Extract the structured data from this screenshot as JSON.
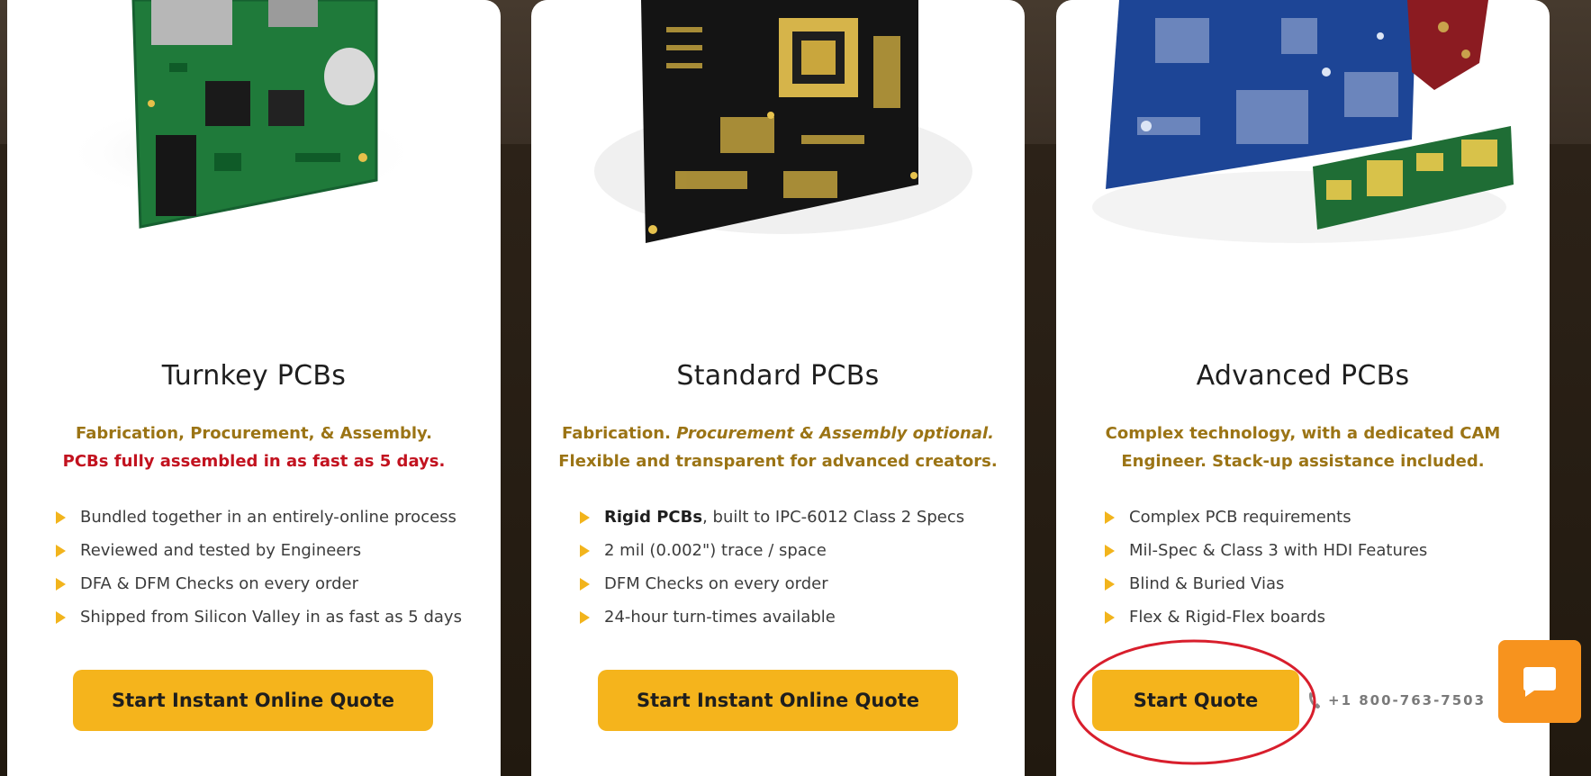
{
  "cards": [
    {
      "title": "Turnkey PCBs",
      "subtitle_line1": "Fabrication, Procurement, & Assembly.",
      "subtitle_line2": "PCBs fully assembled in as fast as 5 days.",
      "features": [
        "Bundled together in an entirely-online process",
        "Reviewed and tested by Engineers",
        "DFA & DFM Checks on every order",
        "Shipped from Silicon Valley in as fast as 5 days"
      ],
      "button_label": "Start Instant Online Quote"
    },
    {
      "title": "Standard PCBs",
      "subtitle_line1_plain": "Fabrication. ",
      "subtitle_line1_italic": "Procurement & Assembly optional.",
      "subtitle_line2": "Flexible and transparent for advanced creators.",
      "features": [
        {
          "bold": "Rigid PCBs",
          "rest": ", built to IPC-6012 Class 2 Specs"
        },
        "2 mil (0.002\") trace / space",
        "DFM Checks on every order",
        "24-hour turn-times available"
      ],
      "button_label": "Start Instant Online Quote"
    },
    {
      "title": "Advanced PCBs",
      "subtitle_line1": "Complex technology, with a dedicated CAM",
      "subtitle_line2": "Engineer. Stack-up assistance included.",
      "features": [
        "Complex PCB requirements",
        "Mil-Spec & Class 3 with HDI Features",
        "Blind & Buried Vias",
        "Flex & Rigid-Flex boards"
      ],
      "button_label": "Start Quote"
    }
  ],
  "phone": {
    "number": "+1 800-763-7503",
    "icon": "phone-icon"
  },
  "chat_widget": {
    "icon": "chat-bubble-icon"
  },
  "annotation": {
    "shape": "ellipse",
    "color": "#d81e2c"
  },
  "colors": {
    "accent": "#f5b41c",
    "subtitle_gold": "#9b7415",
    "subtitle_red": "#c2121f",
    "chat_orange": "#f7931e",
    "pcb_green": "#1c7a3a",
    "pcb_black": "#141414",
    "pcb_blue": "#1a3f8f"
  }
}
